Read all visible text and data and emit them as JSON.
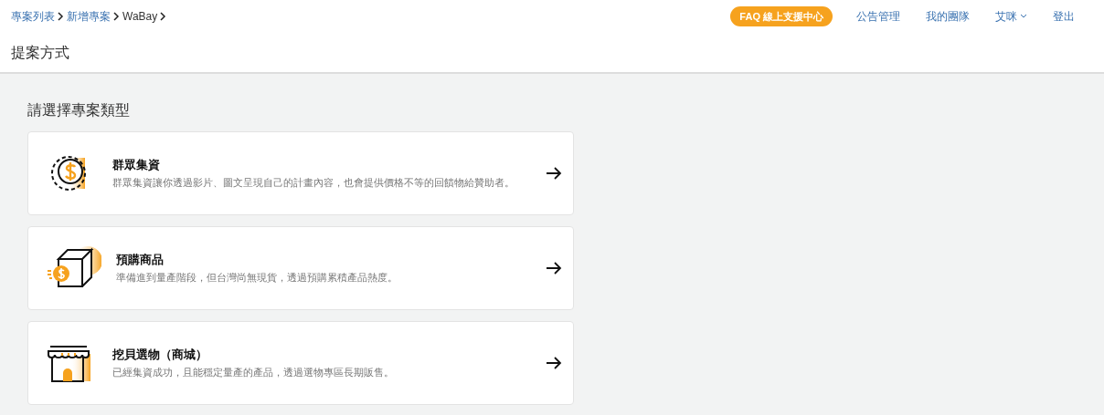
{
  "breadcrumb": [
    {
      "label": "專案列表",
      "link": true
    },
    {
      "label": "新增專案",
      "link": true
    },
    {
      "label": "WaBay",
      "link": false
    }
  ],
  "nav": {
    "faq_button": "FAQ 線上支援中心",
    "links": [
      "公告管理",
      "我的團隊"
    ],
    "user_menu": "艾咪",
    "logout": "登出"
  },
  "page_title": "提案方式",
  "section_title": "請選擇專案類型",
  "options": [
    {
      "kind": "crowdfunding",
      "title": "群眾集資",
      "description": "群眾集資讓你透過影片、圖文呈現自己的計畫內容，也會提供價格不等的回饋物給贊助者。"
    },
    {
      "kind": "preorder",
      "title": "預購商品",
      "description": "準備進到量產階段，但台灣尚無現貨，透過預購累積產品熱度。"
    },
    {
      "kind": "shop",
      "title": "挖貝選物（商城）",
      "description": "已經集資成功，且能穩定量產的產品，透過選物專區長期販售。"
    }
  ]
}
